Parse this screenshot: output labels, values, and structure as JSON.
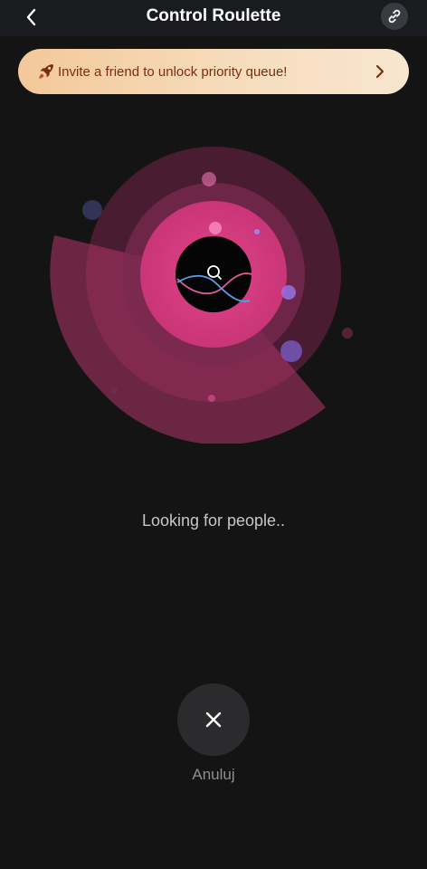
{
  "header": {
    "title": "Control Roulette",
    "back_icon": "chevron-left-icon",
    "link_icon": "link-icon"
  },
  "banner": {
    "icon": "rocket-icon",
    "text": "Invite a friend to unlock priority queue!",
    "chevron_icon": "chevron-right-icon",
    "text_color": "#7a2e0e"
  },
  "search": {
    "icon": "search-icon",
    "status_text": "Looking for people.."
  },
  "cancel": {
    "icon": "close-icon",
    "label": "Anuluj"
  },
  "colors": {
    "background": "#141414",
    "header": "#1a1b1f",
    "accent_pink": "#d8407f",
    "banner_start": "#f3c89a",
    "banner_end": "#f8e6d0"
  }
}
